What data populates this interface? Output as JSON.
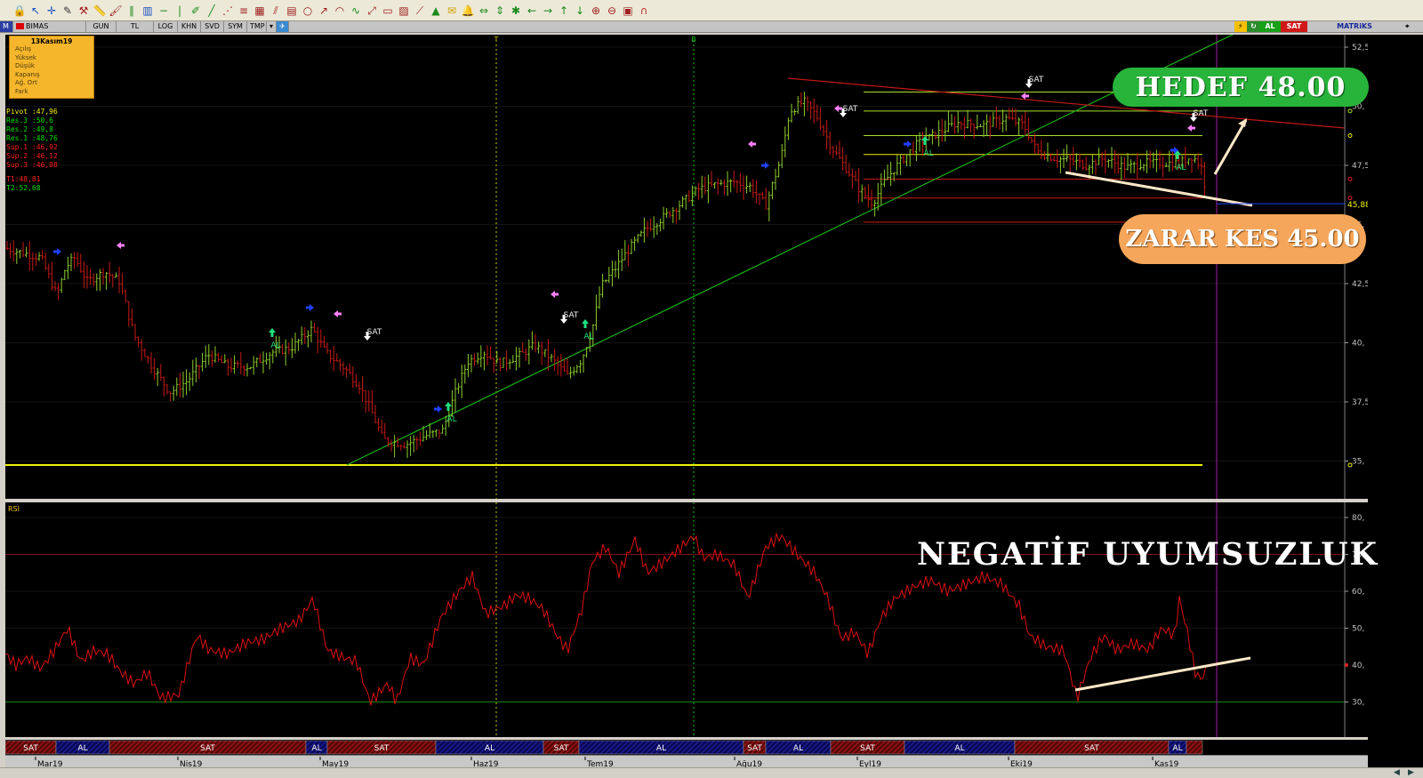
{
  "toolbar": {
    "icons": [
      "lock-icon",
      "cursor-icon",
      "crosshair-icon",
      "pencil-icon",
      "hammer-icon",
      "ruler-icon",
      "brush-icon",
      "parallel-icon",
      "bars-icon",
      "minus-icon",
      "vline-icon",
      "pen-icon",
      "trend-icon",
      "fan-icon",
      "fib-icon",
      "gann-icon",
      "channel-icon",
      "grid-icon",
      "cycle-icon",
      "speed-icon",
      "arc-icon",
      "elliott-icon",
      "regression-icon",
      "box-icon",
      "hatch-icon",
      "zigzag-icon",
      "bucket-icon",
      "note-icon",
      "bell-icon",
      "fit-icon",
      "up-down-icon",
      "star-icon",
      "arrow-left-icon",
      "arrow-right-icon",
      "arrow-up-icon",
      "arrow-down-icon",
      "zoom-in-icon",
      "zoom-out-icon",
      "frame-icon",
      "magnet-icon"
    ]
  },
  "header": {
    "window_symbol": "M",
    "symbol": "BIMAS",
    "period": "GUN",
    "currency": "TL",
    "buttons": [
      "LOG",
      "KHN",
      "SVD",
      "SYM",
      "TMP"
    ],
    "signal_al": "AL",
    "signal_sat": "SAT",
    "system_name": "MATRiKS"
  },
  "info_box": {
    "date": "13Kasım19",
    "rows": [
      "Açılış",
      "Yüksek",
      "Düşük",
      "Kapanış",
      "Ağ. Ort",
      "Fark"
    ]
  },
  "pivots": [
    {
      "label": "Pivot",
      "value": ":47,96",
      "color": "#f0f000"
    },
    {
      "label": "Res.3",
      "value": ":50,6",
      "color": "#00e000"
    },
    {
      "label": "Res.2",
      "value": ":49,8",
      "color": "#00e000"
    },
    {
      "label": "Res.1",
      "value": ":48,76",
      "color": "#00e000"
    },
    {
      "label": "Sup.1",
      "value": ":46,92",
      "color": "#ff2020"
    },
    {
      "label": "Sup.2",
      "value": ":46,12",
      "color": "#ff2020"
    },
    {
      "label": "Sup.3",
      "value": ":46,08",
      "color": "#ff2020"
    },
    {
      "label": "T1:48,81",
      "value": "",
      "color": "#ff2020"
    },
    {
      "label": "T2:52,68",
      "value": "",
      "color": "#00e000"
    }
  ],
  "callouts": {
    "target": "HEDEF 48.00",
    "stop": "ZARAR KES 45.00",
    "divergence": "NEGATİF UYUMSUZLUK"
  },
  "rsi_label": "RSI",
  "price_axis": {
    "labels": [
      "52,5",
      "50,",
      "47,5",
      "45,",
      "42,5",
      "40,",
      "37,5",
      "35,"
    ],
    "values": [
      52.5,
      50,
      47.5,
      45,
      42.5,
      40,
      37.5,
      35
    ],
    "last_price": "45,88"
  },
  "rsi_axis": {
    "labels": [
      "80,",
      "70,",
      "60,",
      "50,",
      "40,",
      "30,"
    ],
    "values": [
      80,
      70,
      60,
      50,
      40,
      30
    ],
    "last_value": "40,"
  },
  "vertical_markers": [
    "T",
    "B"
  ],
  "time_labels": [
    "Mar19",
    "Nis19",
    "May19",
    "Haz19",
    "Tem19",
    "Ağu19",
    "Eyl19",
    "Eki19",
    "Kas19"
  ],
  "signal_strip": [
    {
      "text": "SAT",
      "type": "sat"
    },
    {
      "text": "AL",
      "type": "al"
    },
    {
      "text": "SAT",
      "type": "sat"
    },
    {
      "text": "AL",
      "type": "al"
    },
    {
      "text": "SAT",
      "type": "sat"
    },
    {
      "text": "AL",
      "type": "al"
    },
    {
      "text": "SAT",
      "type": "sat"
    },
    {
      "text": "AL",
      "type": "al"
    },
    {
      "text": "SAT",
      "type": "sat"
    },
    {
      "text": "AL",
      "type": "al"
    },
    {
      "text": "SAT",
      "type": "sat"
    },
    {
      "text": "AL",
      "type": "al"
    },
    {
      "text": "SAT",
      "type": "sat"
    },
    {
      "text": "AL",
      "type": "al"
    },
    {
      "text": "",
      "type": "sat"
    }
  ],
  "chart_signals": [
    "SAT",
    "AL"
  ],
  "colors": {
    "bull_bar": "#8ccc2c",
    "bear_bar": "#c81818",
    "rsi_line": "#e01010",
    "trend_support": "#18b018",
    "trend_resistance": "#c01818",
    "target_bg": "#28b43a",
    "stop_bg": "#f6a65a",
    "pivot_yellow": "#f0f000"
  }
}
